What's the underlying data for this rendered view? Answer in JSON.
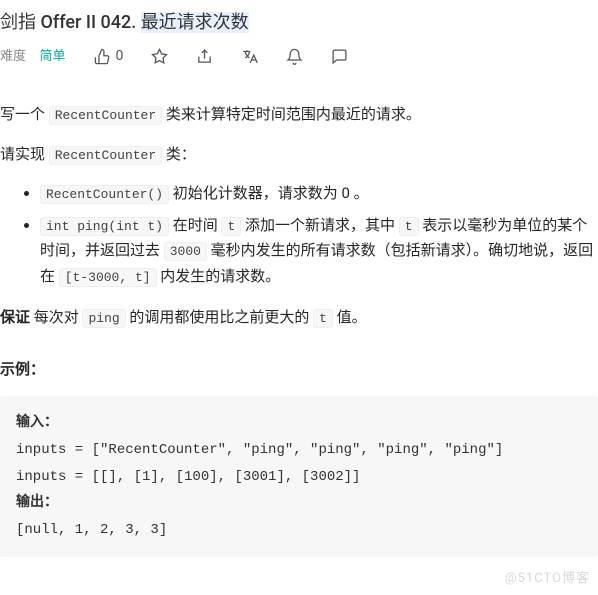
{
  "header": {
    "title_prefix": "剑指 Offer II 042. ",
    "title_hl": "最近请求次数",
    "meta": {
      "difficulty_label": "难度",
      "difficulty_value": "简单",
      "like_count": "0"
    }
  },
  "body": {
    "p1_a": "写一个 ",
    "p1_code": "RecentCounter",
    "p1_b": " 类来计算特定时间范围内最近的请求。",
    "p2_a": "请实现 ",
    "p2_code": "RecentCounter",
    "p2_b": " 类：",
    "li1_code": "RecentCounter()",
    "li1_text": " 初始化计数器，请求数为 0 。",
    "li2_code1": "int ping(int t)",
    "li2_a": " 在时间 ",
    "li2_code2": "t",
    "li2_b": " 添加一个新请求，其中 ",
    "li2_code3": "t",
    "li2_c": " 表示以毫秒为单位的某个时间，并返回过去 ",
    "li2_code4": "3000",
    "li2_d": " 毫秒内发生的所有请求数（包括新请求）。确切地说，返回在 ",
    "li2_code5": "[t-3000, t]",
    "li2_e": " 内发生的请求数。",
    "p3_bold": "保证",
    "p3_a": " 每次对 ",
    "p3_code1": "ping",
    "p3_b": " 的调用都使用比之前更大的 ",
    "p3_code2": "t",
    "p3_c": " 值。",
    "example_label": "示例：",
    "example": {
      "input_label": "输入：",
      "input_line1": "inputs = [\"RecentCounter\", \"ping\", \"ping\", \"ping\", \"ping\"]",
      "input_line2": "inputs = [[], [1], [100], [3001], [3002]]",
      "output_label": "输出：",
      "output_line": "[null, 1, 2, 3, 3]"
    }
  },
  "watermark": "@51CTO博客"
}
